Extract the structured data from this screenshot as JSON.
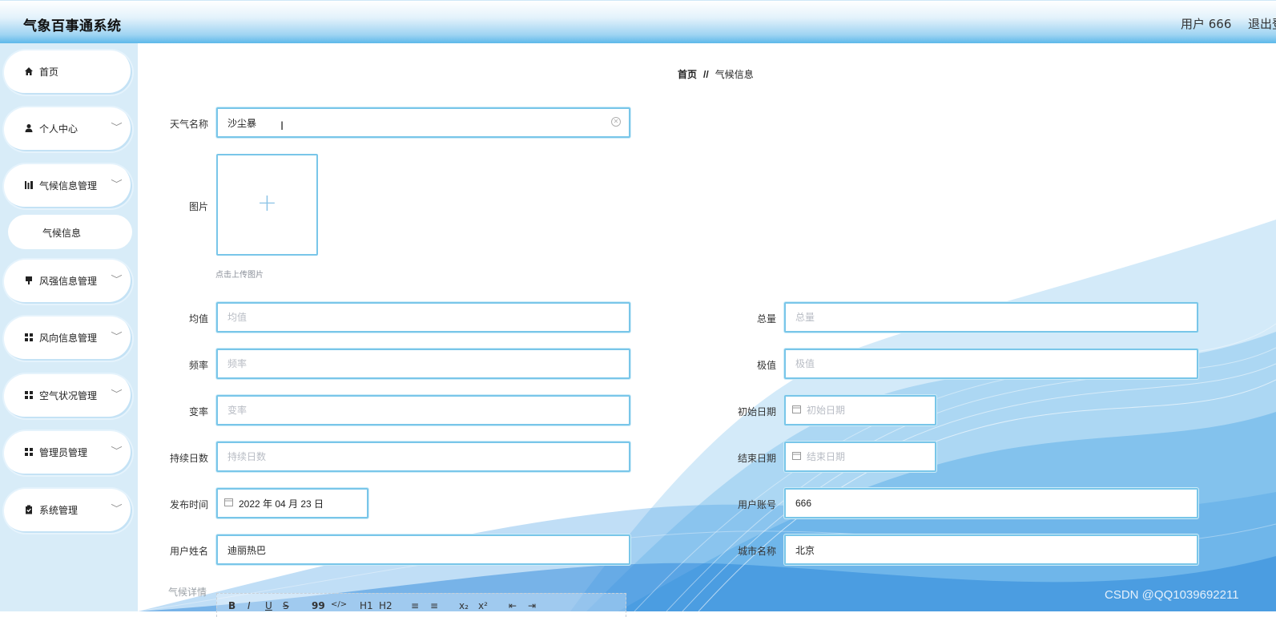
{
  "header": {
    "app_title": "气象百事通系统",
    "user_label": "用户 666",
    "logout_label": "退出登录"
  },
  "sidebar": {
    "items": [
      {
        "label": "首页",
        "icon": "home-icon"
      },
      {
        "label": "个人中心",
        "icon": "user-icon"
      },
      {
        "label": "气候信息管理",
        "icon": "chart-icon"
      },
      {
        "label": "风强信息管理",
        "icon": "flag-icon"
      },
      {
        "label": "风向信息管理",
        "icon": "grid-icon"
      },
      {
        "label": "空气状况管理",
        "icon": "grid-icon"
      },
      {
        "label": "管理员管理",
        "icon": "grid-icon"
      },
      {
        "label": "系统管理",
        "icon": "clipboard-icon"
      }
    ],
    "submenu": {
      "label": "气候信息"
    }
  },
  "breadcrumb": {
    "home": "首页",
    "separator": "//",
    "current": "气候信息"
  },
  "form": {
    "weather_name": {
      "label": "天气名称",
      "value": "沙尘暴"
    },
    "image": {
      "label": "图片",
      "hint": "点击上传图片"
    },
    "mean": {
      "label": "均值",
      "placeholder": "均值"
    },
    "total": {
      "label": "总量",
      "placeholder": "总量"
    },
    "frequency": {
      "label": "频率",
      "placeholder": "频率"
    },
    "extreme": {
      "label": "极值",
      "placeholder": "极值"
    },
    "rate": {
      "label": "变率",
      "placeholder": "变率"
    },
    "start_date": {
      "label": "初始日期",
      "placeholder": "初始日期"
    },
    "duration_days": {
      "label": "持续日数",
      "placeholder": "持续日数"
    },
    "end_date": {
      "label": "结束日期",
      "placeholder": "结束日期"
    },
    "publish_time": {
      "label": "发布时间",
      "value": "2022 年 04 月 23 日"
    },
    "user_account": {
      "label": "用户账号",
      "value": "666"
    },
    "user_name": {
      "label": "用户姓名",
      "value": "迪丽热巴"
    },
    "city_name": {
      "label": "城市名称",
      "value": "北京"
    },
    "details": {
      "label": "气候详情"
    }
  },
  "editor_toolbar": [
    "B",
    "I",
    "U",
    "S",
    "99",
    "</>",
    "H1",
    "H2",
    "≡",
    "≡",
    "x₂",
    "x²",
    "⇤",
    "⇥"
  ],
  "watermark": "CSDN @QQ1039692211"
}
